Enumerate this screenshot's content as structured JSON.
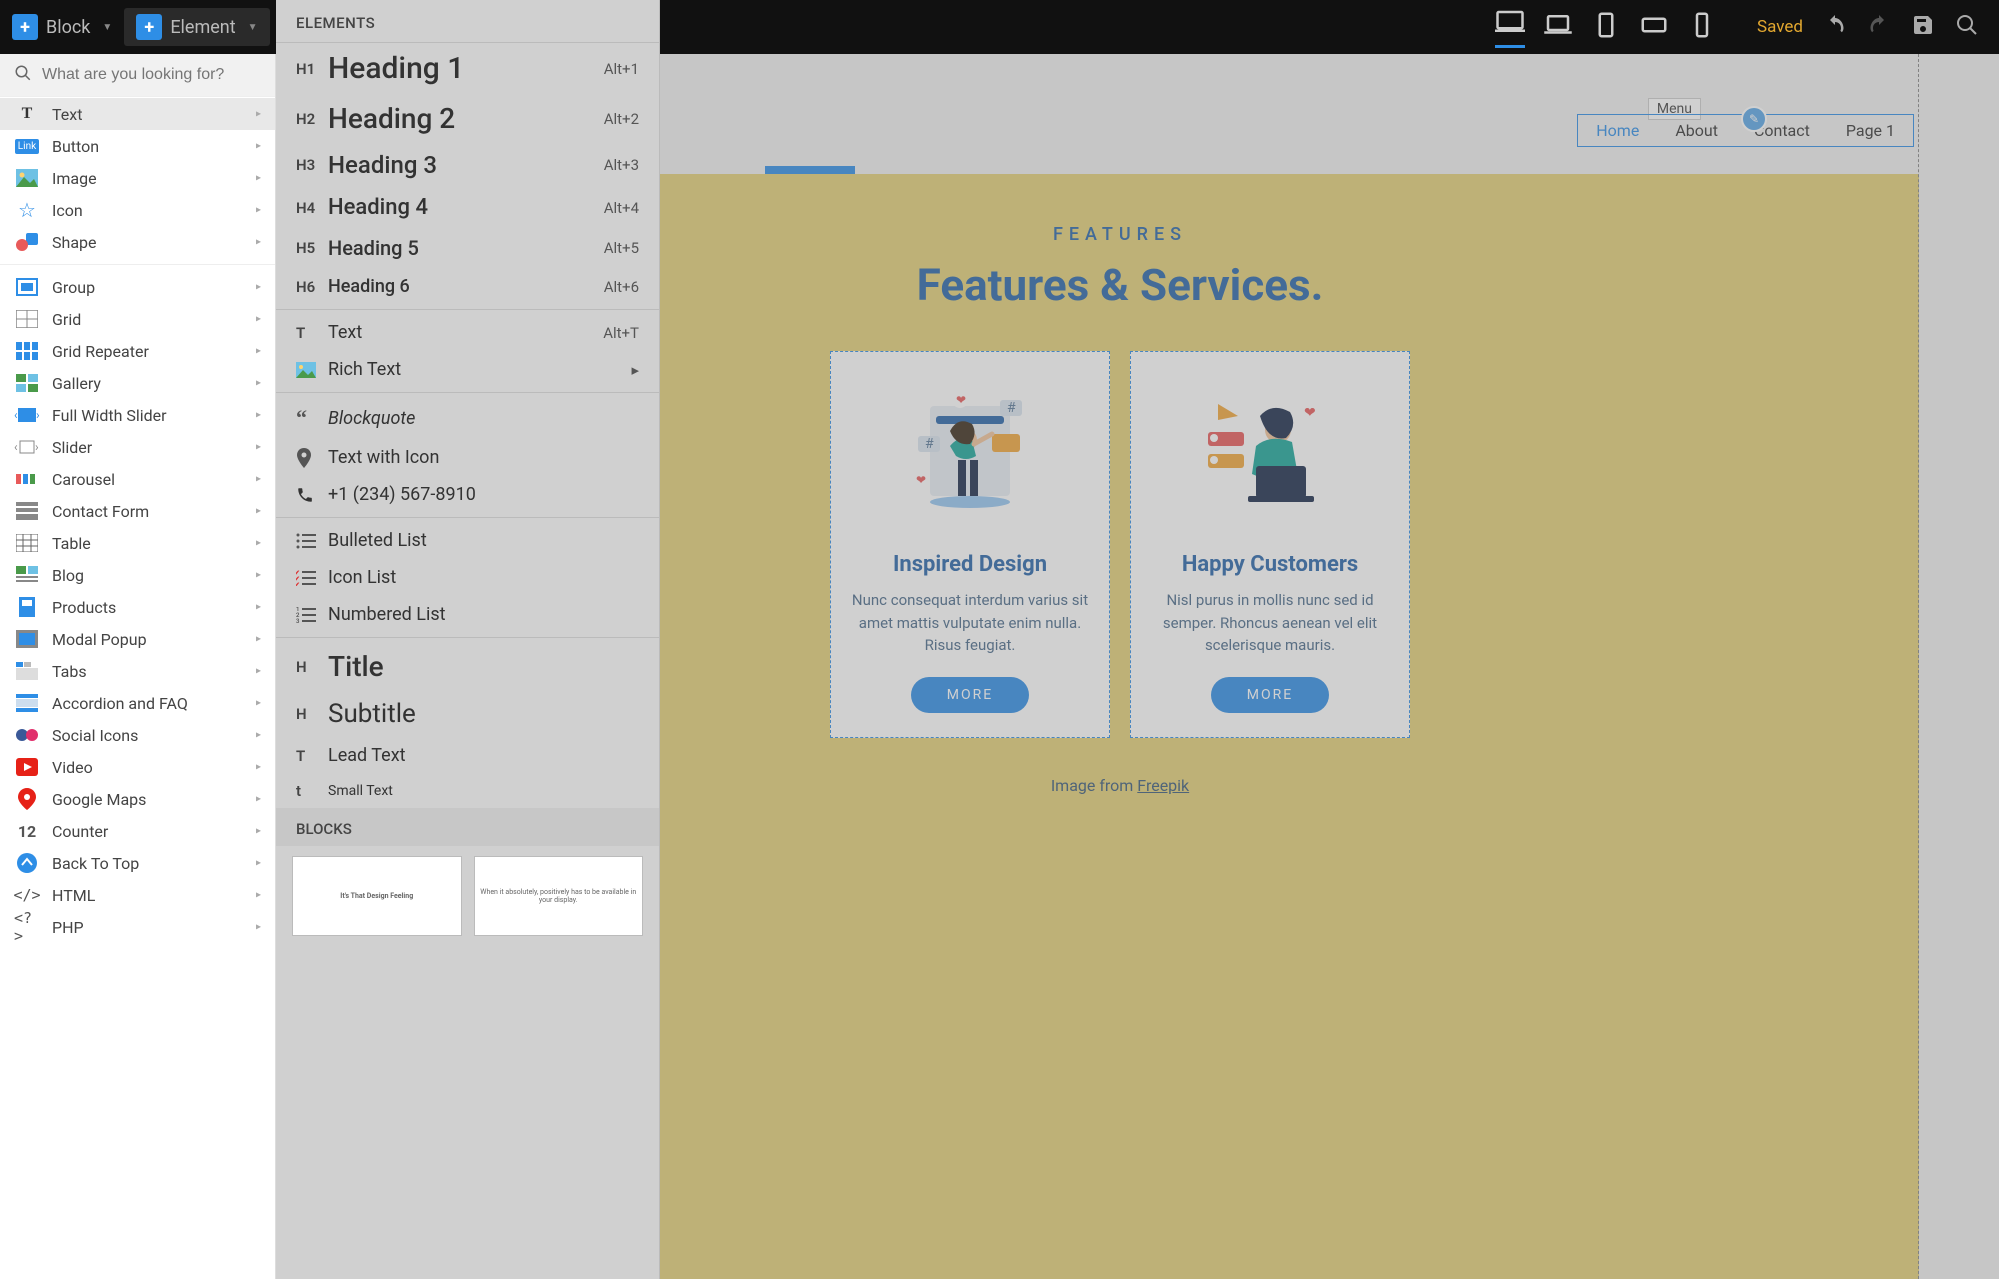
{
  "topbar": {
    "block_label": "Block",
    "element_label": "Element",
    "saved_label": "Saved"
  },
  "search": {
    "placeholder": "What are you looking for?"
  },
  "categories": [
    {
      "icon": "T",
      "label": "Text",
      "highlighted": true
    },
    {
      "icon": "link",
      "label": "Button"
    },
    {
      "icon": "image",
      "label": "Image"
    },
    {
      "icon": "star",
      "label": "Icon"
    },
    {
      "icon": "shape",
      "label": "Shape"
    },
    {
      "sep": true
    },
    {
      "icon": "group",
      "label": "Group"
    },
    {
      "icon": "grid",
      "label": "Grid"
    },
    {
      "icon": "repeater",
      "label": "Grid Repeater"
    },
    {
      "icon": "gallery",
      "label": "Gallery"
    },
    {
      "icon": "fullslider",
      "label": "Full Width Slider"
    },
    {
      "icon": "slider",
      "label": "Slider"
    },
    {
      "icon": "carousel",
      "label": "Carousel"
    },
    {
      "icon": "form",
      "label": "Contact Form"
    },
    {
      "icon": "table",
      "label": "Table"
    },
    {
      "icon": "blog",
      "label": "Blog"
    },
    {
      "icon": "products",
      "label": "Products"
    },
    {
      "icon": "modal",
      "label": "Modal Popup"
    },
    {
      "icon": "tabs",
      "label": "Tabs"
    },
    {
      "icon": "accordion",
      "label": "Accordion and FAQ"
    },
    {
      "icon": "social",
      "label": "Social Icons"
    },
    {
      "icon": "video",
      "label": "Video"
    },
    {
      "icon": "maps",
      "label": "Google Maps"
    },
    {
      "icon": "counter",
      "label": "Counter"
    },
    {
      "icon": "backtotop",
      "label": "Back To Top"
    },
    {
      "icon": "html",
      "label": "HTML"
    },
    {
      "icon": "php",
      "label": "PHP"
    }
  ],
  "flyout": {
    "header": "ELEMENTS",
    "blocks_header": "BLOCKS",
    "items": [
      {
        "cls": "fly-h1",
        "icon": "H1",
        "label": "Heading 1",
        "shortcut": "Alt+1"
      },
      {
        "cls": "fly-h2",
        "icon": "H2",
        "label": "Heading 2",
        "shortcut": "Alt+2"
      },
      {
        "cls": "fly-h3",
        "icon": "H3",
        "label": "Heading 3",
        "shortcut": "Alt+3"
      },
      {
        "cls": "fly-h4",
        "icon": "H4",
        "label": "Heading 4",
        "shortcut": "Alt+4"
      },
      {
        "cls": "fly-h5",
        "icon": "H5",
        "label": "Heading 5",
        "shortcut": "Alt+5"
      },
      {
        "cls": "fly-h6",
        "icon": "H6",
        "label": "Heading 6",
        "shortcut": "Alt+6"
      },
      {
        "sep": true
      },
      {
        "cls": "fly-text",
        "icon": "T",
        "label": "Text",
        "shortcut": "Alt+T"
      },
      {
        "cls": "fly-generic",
        "icon": "rich",
        "label": "Rich Text",
        "chevron": true
      },
      {
        "sep": true
      },
      {
        "cls": "fly-blockquote",
        "icon": "quote",
        "label": "Blockquote"
      },
      {
        "cls": "fly-generic",
        "icon": "pin",
        "label": "Text with Icon"
      },
      {
        "cls": "fly-generic",
        "icon": "phone",
        "label": "+1 (234) 567-8910"
      },
      {
        "sep": true
      },
      {
        "cls": "fly-generic",
        "icon": "bullets",
        "label": "Bulleted List"
      },
      {
        "cls": "fly-generic",
        "icon": "iconlist",
        "label": "Icon List"
      },
      {
        "cls": "fly-generic",
        "icon": "numbers",
        "label": "Numbered List"
      },
      {
        "sep": true
      },
      {
        "cls": "fly-title",
        "icon": "H",
        "label": "Title"
      },
      {
        "cls": "fly-subtitle",
        "icon": "H",
        "label": "Subtitle"
      },
      {
        "cls": "fly-generic",
        "icon": "T",
        "label": "Lead Text"
      },
      {
        "cls": "fly-small",
        "icon": "t",
        "label": "Small Text"
      }
    ],
    "block_thumb1": "It's That Design Feeling",
    "block_thumb2": "When it absolutely, positively has to be available in your display."
  },
  "preview": {
    "menu_label": "Menu",
    "nav": {
      "home": "Home",
      "about": "About",
      "contact": "Contact",
      "page1": "Page 1"
    },
    "features_label": "FEATURES",
    "features_title": "Features & Services.",
    "card1": {
      "title": "Inspired Design",
      "body": "Nunc consequat interdum varius sit amet mattis vulputate enim nulla. Risus feugiat.",
      "button": "MORE"
    },
    "card2": {
      "title": "Happy Customers",
      "body": "Nisl purus in mollis nunc sed id semper. Rhoncus aenean vel elit scelerisque mauris.",
      "button": "MORE"
    },
    "attribution_text": "Image from ",
    "attribution_link": "Freepik"
  }
}
